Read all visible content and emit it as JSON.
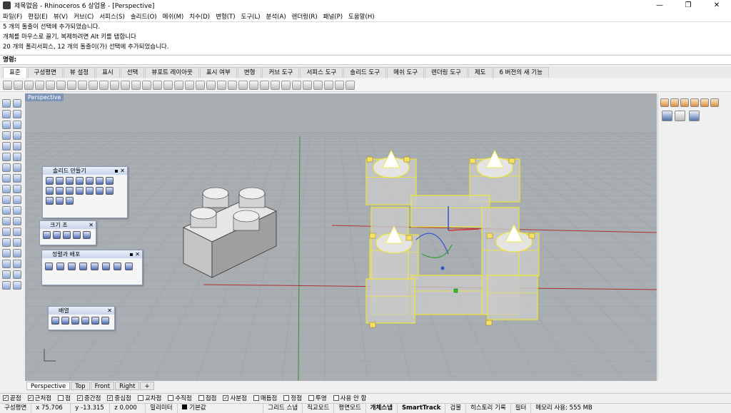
{
  "window": {
    "title": "제목없음 - Rhinoceros 6 상업용 - [Perspective]",
    "buttons": [
      "—",
      "❐",
      "✕"
    ]
  },
  "menu": [
    "파일(F)",
    "편집(E)",
    "뷰(V)",
    "커브(C)",
    "서피스(S)",
    "솔리드(O)",
    "메쉬(M)",
    "치수(D)",
    "변형(T)",
    "도구(L)",
    "분석(A)",
    "렌더링(R)",
    "패널(P)",
    "도움말(H)"
  ],
  "command_history": [
    "5 개의 돌출이 선택에 추가되었습니다.",
    "개체를 마우스로 끌기, 복제하려면 Alt 키를 탭합니다",
    "20 개의 폴리서피스, 12 개의 돌출이(가) 선택에 추가되었습니다."
  ],
  "command_prompt": "명령:",
  "tabs": [
    "표준",
    "구성평면",
    "뷰 설정",
    "표시",
    "선택",
    "뷰포트 레이아웃",
    "표시 여부",
    "변형",
    "커브 도구",
    "서피스 도구",
    "솔리드 도구",
    "메쉬 도구",
    "렌더링 도구",
    "제도",
    "6 버전의 새 기능"
  ],
  "active_tab": "표준",
  "viewport": {
    "name": "Perspective",
    "bg": "#a9aeb3",
    "grid_color": "#9ea3a8",
    "axis_x_color": "#b03030",
    "axis_y_color": "#3a8a3a",
    "selection_color": "#f2ea2a"
  },
  "floating_panels": {
    "solid": {
      "title": "솔리드 만들기"
    },
    "size": {
      "title": "크기 조"
    },
    "align": {
      "title": "정렬과 배포"
    },
    "array": {
      "title": "배열"
    }
  },
  "viewport_tabs": [
    "Perspective",
    "Top",
    "Front",
    "Right",
    "+"
  ],
  "osnaps": [
    {
      "label": "끝점",
      "checked": true
    },
    {
      "label": "근처점",
      "checked": true
    },
    {
      "label": "점",
      "checked": false
    },
    {
      "label": "중간점",
      "checked": true
    },
    {
      "label": "중심점",
      "checked": true
    },
    {
      "label": "교차점",
      "checked": false
    },
    {
      "label": "수직점",
      "checked": false
    },
    {
      "label": "접점",
      "checked": false
    },
    {
      "label": "사분점",
      "checked": true
    },
    {
      "label": "매듭점",
      "checked": false
    },
    {
      "label": "정점",
      "checked": false
    },
    {
      "label": "투영",
      "checked": false
    },
    {
      "label": "사용 안 함",
      "checked": false
    }
  ],
  "status": {
    "cplane": "구성평면",
    "x": "x 75.706",
    "y": "y -13.315",
    "z": "z 0.000",
    "units": "밀리미터",
    "layer": "기본값",
    "toggles": [
      "그리드 스냅",
      "직교모드",
      "평면모드",
      "개체스냅",
      "SmartTrack",
      "검볼",
      "히스토리 기록",
      "필터"
    ],
    "memory": "메모리 사용: 555 MB"
  }
}
